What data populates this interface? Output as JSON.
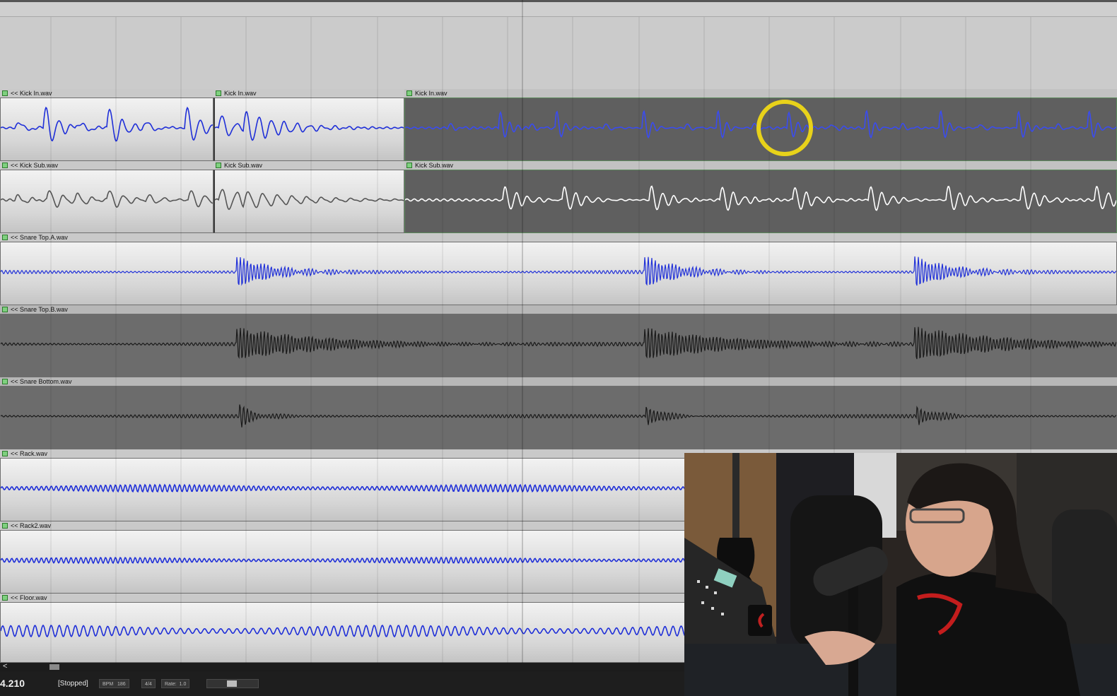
{
  "tracks": [
    {
      "id": "kick-in",
      "clips": [
        {
          "label": "<< Kick In.wav",
          "theme": "light",
          "color": "#1f2fd8",
          "pattern": "kick"
        },
        {
          "label": "Kick In.wav",
          "theme": "light",
          "color": "#1f2fd8",
          "pattern": "kick-decay"
        },
        {
          "label": "Kick In.wav",
          "theme": "dark",
          "selected": true,
          "color": "#3a4cf0",
          "pattern": "kick-sparse"
        }
      ]
    },
    {
      "id": "kick-sub",
      "clips": [
        {
          "label": "<< Kick Sub.wav",
          "theme": "light",
          "color": "#555555",
          "pattern": "sub"
        },
        {
          "label": "Kick Sub.wav",
          "theme": "light",
          "color": "#555555",
          "pattern": "sub-decay"
        },
        {
          "label": "Kick Sub.wav",
          "theme": "dark",
          "selected": true,
          "color": "#ffffff",
          "pattern": "sub-sparse"
        }
      ]
    },
    {
      "id": "snare-top-a",
      "clips": [
        {
          "label": "<< Snare Top.A.wav",
          "theme": "light",
          "color": "#1f2fd8",
          "pattern": "snare"
        }
      ]
    },
    {
      "id": "snare-top-b",
      "clips": [
        {
          "label": "<< Snare Top.B.wav",
          "theme": "dark",
          "color": "#1a1a1a",
          "pattern": "snare-dense"
        }
      ]
    },
    {
      "id": "snare-bottom",
      "clips": [
        {
          "label": "<< Snare Bottom.wav",
          "theme": "dark",
          "color": "#1a1a1a",
          "pattern": "snare-small"
        }
      ]
    },
    {
      "id": "rack",
      "clips": [
        {
          "label": "<< Rack.wav",
          "theme": "light",
          "color": "#1f2fd8",
          "pattern": "tom"
        }
      ]
    },
    {
      "id": "rack2",
      "clips": [
        {
          "label": "<< Rack2.wav",
          "theme": "light",
          "color": "#1f2fd8",
          "pattern": "tom2"
        }
      ]
    },
    {
      "id": "floor",
      "clips": [
        {
          "label": "<< Floor.wav",
          "theme": "light",
          "color": "#1f2fd8",
          "pattern": "floor"
        }
      ]
    }
  ],
  "status": {
    "time": "4.210",
    "state": "[Stopped]",
    "bpm_label": "BPM",
    "bpm_value": "186",
    "meter": "4/4",
    "rate_label": "Rate:",
    "rate_value": "1.0"
  },
  "scroll": {
    "left_arrow": "<"
  },
  "icons": {
    "clip_badge": "green-clip-icon",
    "scroll_left": "chevron-left-icon"
  },
  "colors": {
    "highlight_ring": "#e8d21a",
    "selection": "#58a858"
  }
}
